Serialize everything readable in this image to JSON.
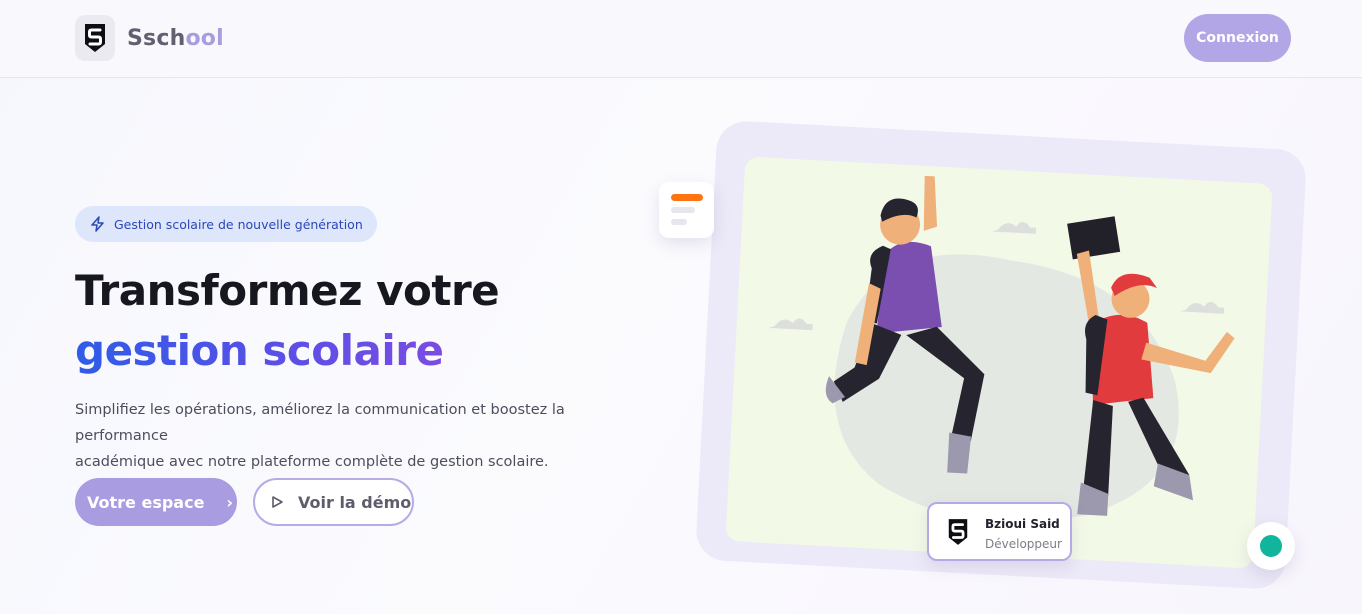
{
  "header": {
    "brand_part1": "Ssch",
    "brand_part2": "ool",
    "logo_icon": "shield-s-logo",
    "login_label": "Connexion"
  },
  "hero": {
    "badge_icon": "lightning-icon",
    "badge_text": "Gestion scolaire de nouvelle génération",
    "title_line1": "Transformez votre",
    "title_line2": "gestion scolaire",
    "description_line1": "Simplifiez les opérations, améliorez la communication et boostez la performance",
    "description_line2": "académique avec notre plateforme complète de gestion scolaire.",
    "primary_button": "Votre espace",
    "primary_button_icon": "chevron-right-icon",
    "secondary_button": "Voir la démo",
    "secondary_button_icon": "play-icon"
  },
  "illustration": {
    "profile_name": "Bzioui Said",
    "profile_role": "Développeur",
    "status_color": "#11b59c"
  },
  "colors": {
    "accent": "#a99ce0",
    "brand_blue": "#2f5ce8",
    "badge_bg": "#dde6fb",
    "orange": "#ff7411"
  }
}
